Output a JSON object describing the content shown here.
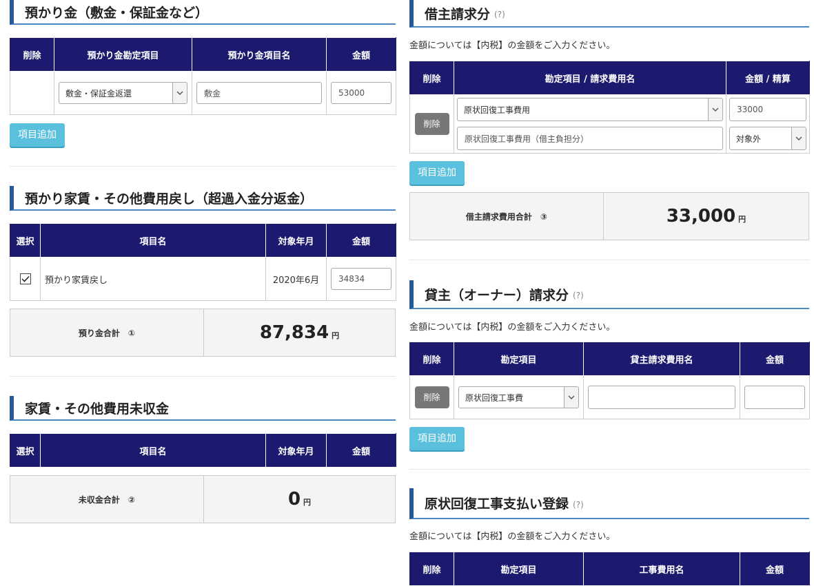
{
  "deposit": {
    "title": "預かり金（敷金・保証金など）",
    "headers": [
      "削除",
      "預かり金勘定項目",
      "預かり金項目名",
      "金額"
    ],
    "row": {
      "account": "敷金・保証金返還",
      "name": "敷金",
      "amount": "53000"
    },
    "add_label": "項目追加"
  },
  "rent_refund": {
    "title": "預かり家賃・その他費用戻し（超過入金分返金）",
    "headers": [
      "選択",
      "項目名",
      "対象年月",
      "金額"
    ],
    "row": {
      "name": "預かり家賃戻し",
      "month": "2020年6月",
      "amount": "34834"
    },
    "total_label": "預り金合計　①",
    "total_value": "87,834",
    "yen": "円"
  },
  "unpaid": {
    "title": "家賃・その他費用未収金",
    "headers": [
      "選択",
      "項目名",
      "対象年月",
      "金額"
    ],
    "total_label": "未収金合計　②",
    "total_value": "0",
    "yen": "円"
  },
  "tenant": {
    "title": "借主請求分",
    "help": "(?)",
    "note": "金額については【内税】の金額をご入力ください。",
    "headers": [
      "削除",
      "勘定項目 / 請求費用名",
      "金額 / 精算"
    ],
    "row": {
      "delete": "削除",
      "account": "原状回復工事費用",
      "amount": "33000",
      "name": "原状回復工事費用（借主負担分）",
      "settle": "対象外"
    },
    "add_label": "項目追加",
    "total_label": "借主請求費用合計　③",
    "total_value": "33,000",
    "yen": "円"
  },
  "owner": {
    "title": "貸主（オーナー）請求分",
    "help": "(?)",
    "note": "金額については【内税】の金額をご入力ください。",
    "headers": [
      "削除",
      "勘定項目",
      "貸主請求費用名",
      "金額"
    ],
    "row": {
      "delete": "削除",
      "account": "原状回復工事費",
      "name": "",
      "amount": ""
    },
    "add_label": "項目追加"
  },
  "repair": {
    "title": "原状回復工事支払い登録",
    "help": "(?)",
    "note": "金額については【内税】の金額をご入力ください。",
    "headers": [
      "削除",
      "勘定項目",
      "工事費用名",
      "金額"
    ]
  }
}
